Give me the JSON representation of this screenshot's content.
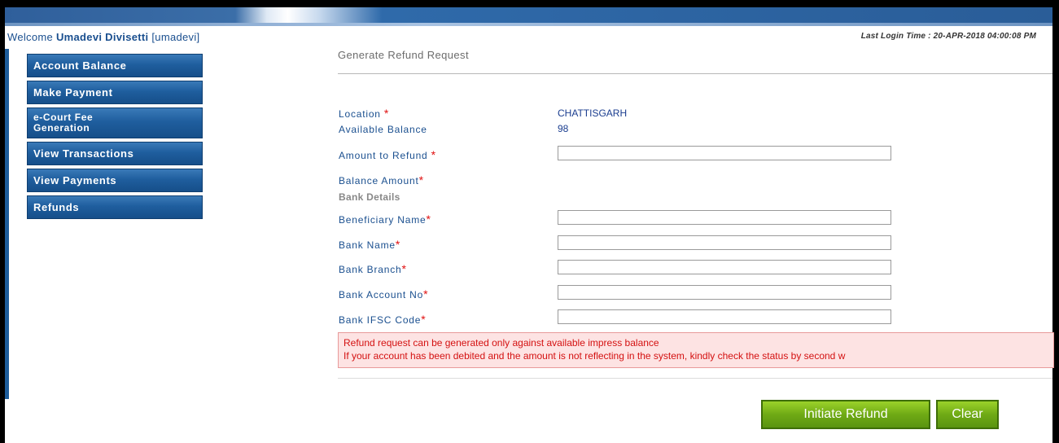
{
  "header": {
    "welcome_prefix": "Welcome",
    "user_display": "Umadevi Divisetti",
    "username": "[umadevi]",
    "last_login": "Last Login Time : 20-APR-2018 04:00:08 PM"
  },
  "sidebar": {
    "items": [
      {
        "label": "Account Balance"
      },
      {
        "label": "Make Payment"
      },
      {
        "label": "e-Court Fee Generation"
      },
      {
        "label": "View Transactions"
      },
      {
        "label": "View Payments"
      },
      {
        "label": "Refunds"
      }
    ]
  },
  "page": {
    "title": "Generate Refund Request"
  },
  "form": {
    "location_label": "Location",
    "location_value": "CHATTISGARH",
    "available_balance_label": "Available Balance",
    "available_balance_value": "98",
    "amount_label": "Amount to Refund",
    "amount_value": "",
    "balance_amount_label": "Balance Amount",
    "bank_details_label": "Bank Details",
    "beneficiary_label": "Beneficiary Name",
    "beneficiary_value": "",
    "bank_name_label": "Bank Name",
    "bank_name_value": "",
    "bank_branch_label": "Bank Branch",
    "bank_branch_value": "",
    "account_no_label": "Bank Account No",
    "account_no_value": "",
    "ifsc_label": "Bank IFSC Code",
    "ifsc_value": "",
    "required_marker": "*"
  },
  "notice": {
    "line1": "Refund request can be generated only against available impress balance",
    "line2": "If your account has been debited and the amount is not reflecting in the system, kindly check the status by second w"
  },
  "buttons": {
    "initiate": "Initiate Refund",
    "clear": "Clear"
  },
  "colors": {
    "accent_blue": "#1a4f8f",
    "sidebar_blue": "#1f5e9e",
    "button_green": "#6faa15",
    "required_red": "#e01010"
  }
}
